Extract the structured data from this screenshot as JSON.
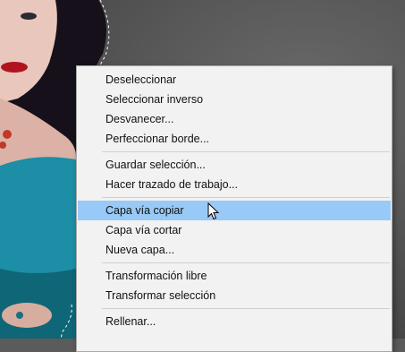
{
  "context_menu": {
    "groups": [
      [
        "Deseleccionar",
        "Seleccionar inverso",
        "Desvanecer...",
        "Perfeccionar borde..."
      ],
      [
        "Guardar selección...",
        "Hacer trazado de trabajo..."
      ],
      [
        "Capa vía copiar",
        "Capa vía cortar",
        "Nueva capa..."
      ],
      [
        "Transformación libre",
        "Transformar selección"
      ],
      [
        "Rellenar..."
      ]
    ],
    "highlighted_item": "Capa vía copiar"
  },
  "colors": {
    "highlight": "#98c9f7",
    "menu_background": "#f2f2f2",
    "canvas_background": "#5b5b5b"
  }
}
